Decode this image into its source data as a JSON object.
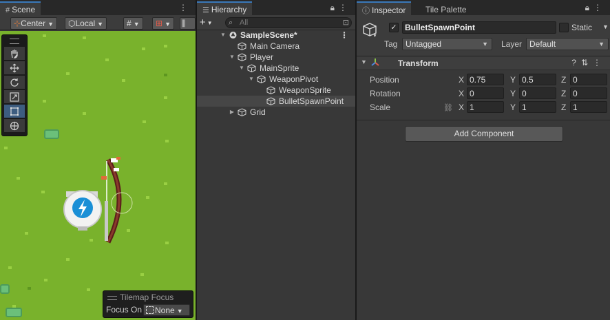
{
  "scene": {
    "tab": "Scene",
    "pivot_mode": "Center",
    "pivot_rotation": "Local",
    "tilemap_focus": {
      "title": "Tilemap Focus",
      "label": "Focus On",
      "value": "None"
    }
  },
  "hierarchy": {
    "tab": "Hierarchy",
    "search_placeholder": "All",
    "items": [
      {
        "label": "SampleScene*",
        "depth": 0,
        "expanded": true,
        "is_scene": true
      },
      {
        "label": "Main Camera",
        "depth": 1
      },
      {
        "label": "Player",
        "depth": 1,
        "expanded": true
      },
      {
        "label": "MainSprite",
        "depth": 2,
        "expanded": true
      },
      {
        "label": "WeaponPivot",
        "depth": 3,
        "expanded": true
      },
      {
        "label": "WeaponSprite",
        "depth": 4
      },
      {
        "label": "BulletSpawnPoint",
        "depth": 4,
        "selected": true
      },
      {
        "label": "Grid",
        "depth": 1,
        "expanded": false
      }
    ]
  },
  "inspector": {
    "tab": "Inspector",
    "tab2": "Tile Palette",
    "object_name": "BulletSpawnPoint",
    "active": true,
    "static_label": "Static",
    "tag_label": "Tag",
    "tag_value": "Untagged",
    "layer_label": "Layer",
    "layer_value": "Default",
    "component": "Transform",
    "position": {
      "label": "Position",
      "x": "0.75",
      "y": "0.5",
      "z": "0"
    },
    "rotation": {
      "label": "Rotation",
      "x": "0",
      "y": "0",
      "z": "0"
    },
    "scale": {
      "label": "Scale",
      "x": "1",
      "y": "1",
      "z": "1"
    },
    "add_component": "Add Component"
  },
  "colors": {
    "accent": "#3a79bb",
    "grass": "#79b22c",
    "panel": "#383838"
  }
}
